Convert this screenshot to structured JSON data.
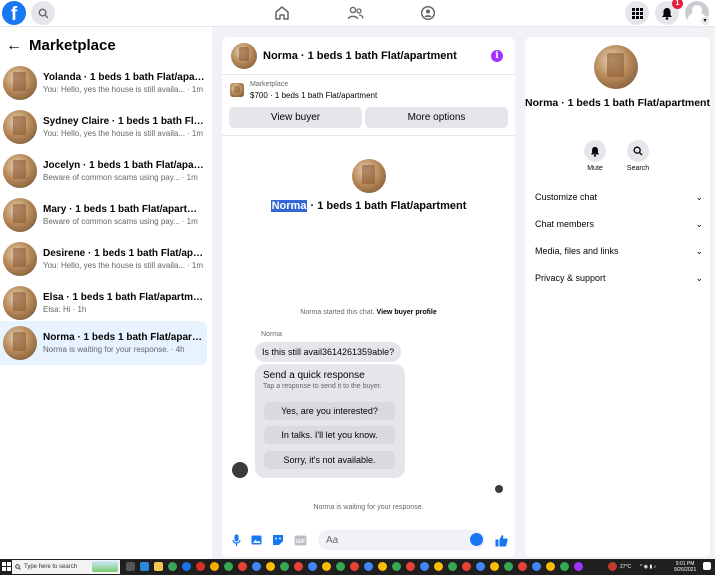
{
  "topbar": {
    "logo_letter": "f",
    "notification_count": "1"
  },
  "sidebar": {
    "title": "Marketplace",
    "conversations": [
      {
        "title": "Yolanda · 1 beds 1 bath Flat/apart...",
        "preview": "You: Hello, yes the house is still availa...",
        "time": "· 1m"
      },
      {
        "title": "Sydney Claire · 1 beds 1 bath Flat/a...",
        "preview": "You: Hello, yes the house is still availa...",
        "time": "· 1m"
      },
      {
        "title": "Jocelyn · 1 beds 1 bath Flat/apartm...",
        "preview": "Beware of common scams using pay...",
        "time": "· 1m"
      },
      {
        "title": "Mary · 1 beds 1 bath Flat/apartment",
        "preview": "Beware of common scams using pay...",
        "time": "· 1m"
      },
      {
        "title": "Desirene · 1 beds 1 bath Flat/apart...",
        "preview": "You: Hello, yes the house is still availa...",
        "time": "· 1m"
      },
      {
        "title": "Elsa · 1 beds 1 bath Flat/apartment",
        "preview": "Elsa: Hi",
        "time": "· 1h"
      },
      {
        "title": "Norma · 1 beds 1 bath Flat/apartm...",
        "preview": "Norma is waiting for your response.",
        "time": "· 4h"
      }
    ]
  },
  "chat": {
    "header_title": "Norma · 1 beds 1 bath Flat/apartment",
    "listing_category": "Marketplace",
    "listing_price_title": "$700 · 1 beds 1 bath Flat/apartment",
    "view_buyer_label": "View buyer",
    "more_options_label": "More options",
    "profile_name_highlight": "Norma",
    "profile_name_rest": " · 1 beds 1 bath Flat/apartment",
    "started_text": "Norma started this chat.",
    "view_profile_link": "View buyer profile",
    "sender_name": "Norma",
    "message": "Is this still avail3614261359able?",
    "quick_title": "Send a quick response",
    "quick_subtitle": "Tap a response to send it to the buyer.",
    "quick_replies": [
      "Yes, are you interested?",
      "In talks. I'll let you know.",
      "Sorry, it's not available."
    ],
    "waiting_text": "Norma is waiting for your response.",
    "composer_placeholder": "Aa",
    "gif_label": "GIF"
  },
  "right_panel": {
    "name": "Norma · 1 beds 1 bath Flat/apartment",
    "mute_label": "Mute",
    "search_label": "Search",
    "sections": [
      "Customize chat",
      "Chat members",
      "Media, files and links",
      "Privacy & support"
    ]
  },
  "taskbar": {
    "search_placeholder": "Type here to search",
    "temperature": "27°C",
    "time": "9:01 PM",
    "date": "9/26/2021"
  },
  "colors": {
    "brand_blue": "#1877f2",
    "info_purple": "#a033ff",
    "active_conversation_bg": "#e7f3ff",
    "notification_red": "#e41e3f"
  }
}
